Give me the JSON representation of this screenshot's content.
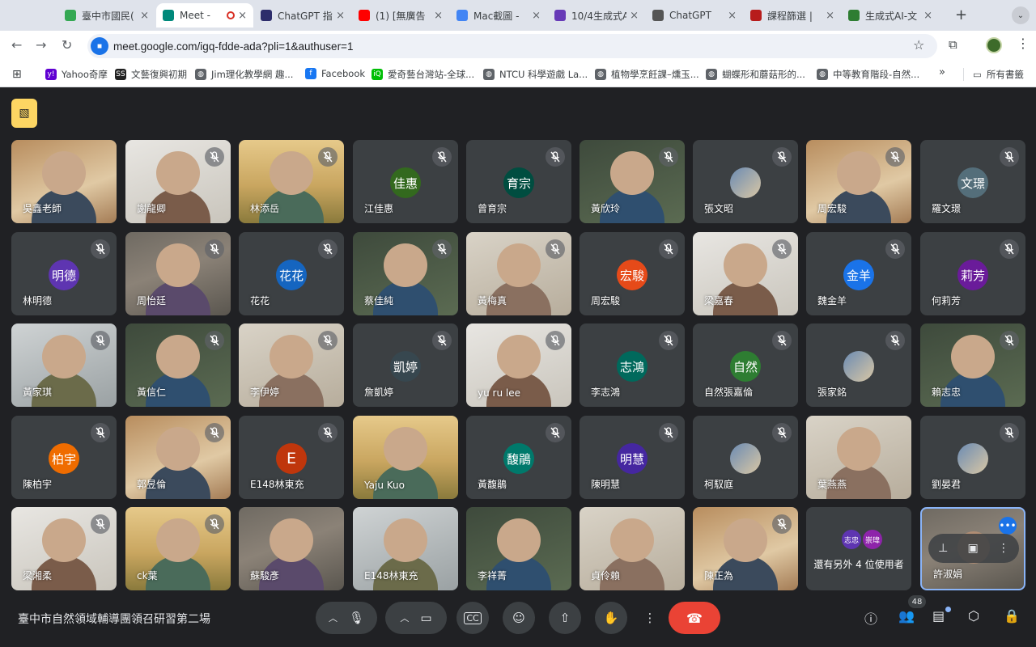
{
  "browser": {
    "tabs": [
      {
        "title": "臺中市國民(",
        "active": false,
        "color": "#34a853"
      },
      {
        "title": "Meet - ",
        "active": true,
        "color": "#00897b",
        "recording": true
      },
      {
        "title": "ChatGPT 指",
        "active": false,
        "color": "#2d2d6b"
      },
      {
        "title": "(1) [無廣告",
        "active": false,
        "color": "#ff0000"
      },
      {
        "title": "Mac截圖 -",
        "active": false,
        "color": "#4285f4"
      },
      {
        "title": "10/4生成式A",
        "active": false,
        "color": "#673ab7"
      },
      {
        "title": "ChatGPT",
        "active": false,
        "color": "#555555"
      },
      {
        "title": "課程篩選 |",
        "active": false,
        "color": "#b71c1c"
      },
      {
        "title": "生成式AI-文",
        "active": false,
        "color": "#2e7d32"
      }
    ],
    "url": "meet.google.com/igq-fdde-ada?pli=1&authuser=1",
    "bookmarks": [
      {
        "label": "Yahoo奇摩",
        "color": "#6001d2",
        "glyph": "y!"
      },
      {
        "label": "文藝復興初期",
        "color": "#222222",
        "glyph": "SS"
      },
      {
        "label": "Jim理化教學網 趣...",
        "color": "#5f6368",
        "glyph": "◍"
      },
      {
        "label": "Facebook",
        "color": "#1877f2",
        "glyph": "f"
      },
      {
        "label": "愛奇藝台灣站-全球...",
        "color": "#00be06",
        "glyph": "iQ"
      },
      {
        "label": "NTCU 科學遊戲 La...",
        "color": "#5f6368",
        "glyph": "◍"
      },
      {
        "label": "植物學烹飪課–燻玉...",
        "color": "#5f6368",
        "glyph": "◍"
      },
      {
        "label": "蝴蝶形和蘑菇形的...",
        "color": "#5f6368",
        "glyph": "◍"
      },
      {
        "label": "中等教育階段-自然...",
        "color": "#5f6368",
        "glyph": "◍"
      }
    ],
    "all_bookmarks_label": "所有書籤"
  },
  "meet": {
    "participants": [
      {
        "name": "吳鑫老師",
        "type": "video",
        "muted": false
      },
      {
        "name": "謝龍卿",
        "type": "video",
        "muted": true
      },
      {
        "name": "林添岳",
        "type": "video",
        "muted": true
      },
      {
        "name": "江佳惠",
        "type": "avatar",
        "initials": "佳惠",
        "color": "#33691e",
        "muted": true
      },
      {
        "name": "曾育宗",
        "type": "avatar",
        "initials": "育宗",
        "color": "#004d40",
        "muted": true
      },
      {
        "name": "黃欣玲",
        "type": "video",
        "muted": true
      },
      {
        "name": "張文昭",
        "type": "photo",
        "muted": true
      },
      {
        "name": "周宏駿",
        "type": "video",
        "muted": true
      },
      {
        "name": "羅文璟",
        "type": "avatar",
        "initials": "文璟",
        "color": "#546e7a",
        "muted": true
      },
      {
        "name": "林明德",
        "type": "avatar",
        "initials": "明德",
        "color": "#5e35b1",
        "muted": true
      },
      {
        "name": "周怡廷",
        "type": "video",
        "muted": true
      },
      {
        "name": "花花",
        "type": "avatar",
        "initials": "花花",
        "color": "#1565c0",
        "muted": true
      },
      {
        "name": "蔡佳純",
        "type": "video",
        "muted": true
      },
      {
        "name": "黃梅真",
        "type": "video",
        "muted": true
      },
      {
        "name": "周宏駿",
        "type": "avatar",
        "initials": "宏駿",
        "color": "#e64a19",
        "muted": true
      },
      {
        "name": "梁嘉春",
        "type": "video",
        "muted": true
      },
      {
        "name": "魏金羊",
        "type": "avatar",
        "initials": "金羊",
        "color": "#1a73e8",
        "muted": true
      },
      {
        "name": "何莉芳",
        "type": "avatar",
        "initials": "莉芳",
        "color": "#6a1b9a",
        "muted": true
      },
      {
        "name": "黃家琪",
        "type": "video",
        "muted": true
      },
      {
        "name": "黃信仁",
        "type": "video",
        "muted": true
      },
      {
        "name": "李伊婷",
        "type": "video",
        "muted": true
      },
      {
        "name": "詹凱婷",
        "type": "avatar",
        "initials": "凱婷",
        "color": "#37474f",
        "muted": true
      },
      {
        "name": "yu ru lee",
        "type": "video",
        "muted": true
      },
      {
        "name": "李志鴻",
        "type": "avatar",
        "initials": "志鴻",
        "color": "#00695c",
        "muted": true
      },
      {
        "name": "自然張嘉倫",
        "type": "avatar",
        "initials": "自然",
        "color": "#2e7d32",
        "muted": true
      },
      {
        "name": "張家銘",
        "type": "photo",
        "muted": true
      },
      {
        "name": "賴志忠",
        "type": "video",
        "muted": true
      },
      {
        "name": "陳柏宇",
        "type": "avatar",
        "initials": "柏宇",
        "color": "#ef6c00",
        "muted": true
      },
      {
        "name": "郭昱倫",
        "type": "video",
        "muted": true
      },
      {
        "name": "E148林東充",
        "type": "avatar",
        "initials": "E",
        "color": "#bf360c",
        "muted": true
      },
      {
        "name": "Yaju Kuo",
        "type": "video",
        "muted": false
      },
      {
        "name": "黃馥鵑",
        "type": "avatar",
        "initials": "馥鵑",
        "color": "#00796b",
        "muted": true
      },
      {
        "name": "陳明慧",
        "type": "avatar",
        "initials": "明慧",
        "color": "#4527a0",
        "muted": true
      },
      {
        "name": "柯馭庭",
        "type": "photo",
        "muted": true
      },
      {
        "name": "葉燕燕",
        "type": "video",
        "muted": false
      },
      {
        "name": "劉晏君",
        "type": "photo",
        "muted": true
      },
      {
        "name": "梁湘柔",
        "type": "video",
        "muted": true
      },
      {
        "name": "ck葉",
        "type": "video",
        "muted": true
      },
      {
        "name": "蘇駿彥",
        "type": "video",
        "muted": false
      },
      {
        "name": "E148林東充",
        "type": "video",
        "muted": false
      },
      {
        "name": "李祥菁",
        "type": "video",
        "muted": false
      },
      {
        "name": "貞伶賴",
        "type": "video",
        "muted": false
      },
      {
        "name": "陳正為",
        "type": "video",
        "muted": true
      }
    ],
    "others": {
      "label": "還有另外 4 位使用者",
      "avatars": [
        {
          "initials": "志忠",
          "color": "#5e35b1"
        },
        {
          "initials": "崇瑋",
          "color": "#8e24aa"
        }
      ]
    },
    "self_name": "許淑娟",
    "meeting_title": "臺中市自然領域輔導團領召研習第二場",
    "people_count": "48"
  }
}
